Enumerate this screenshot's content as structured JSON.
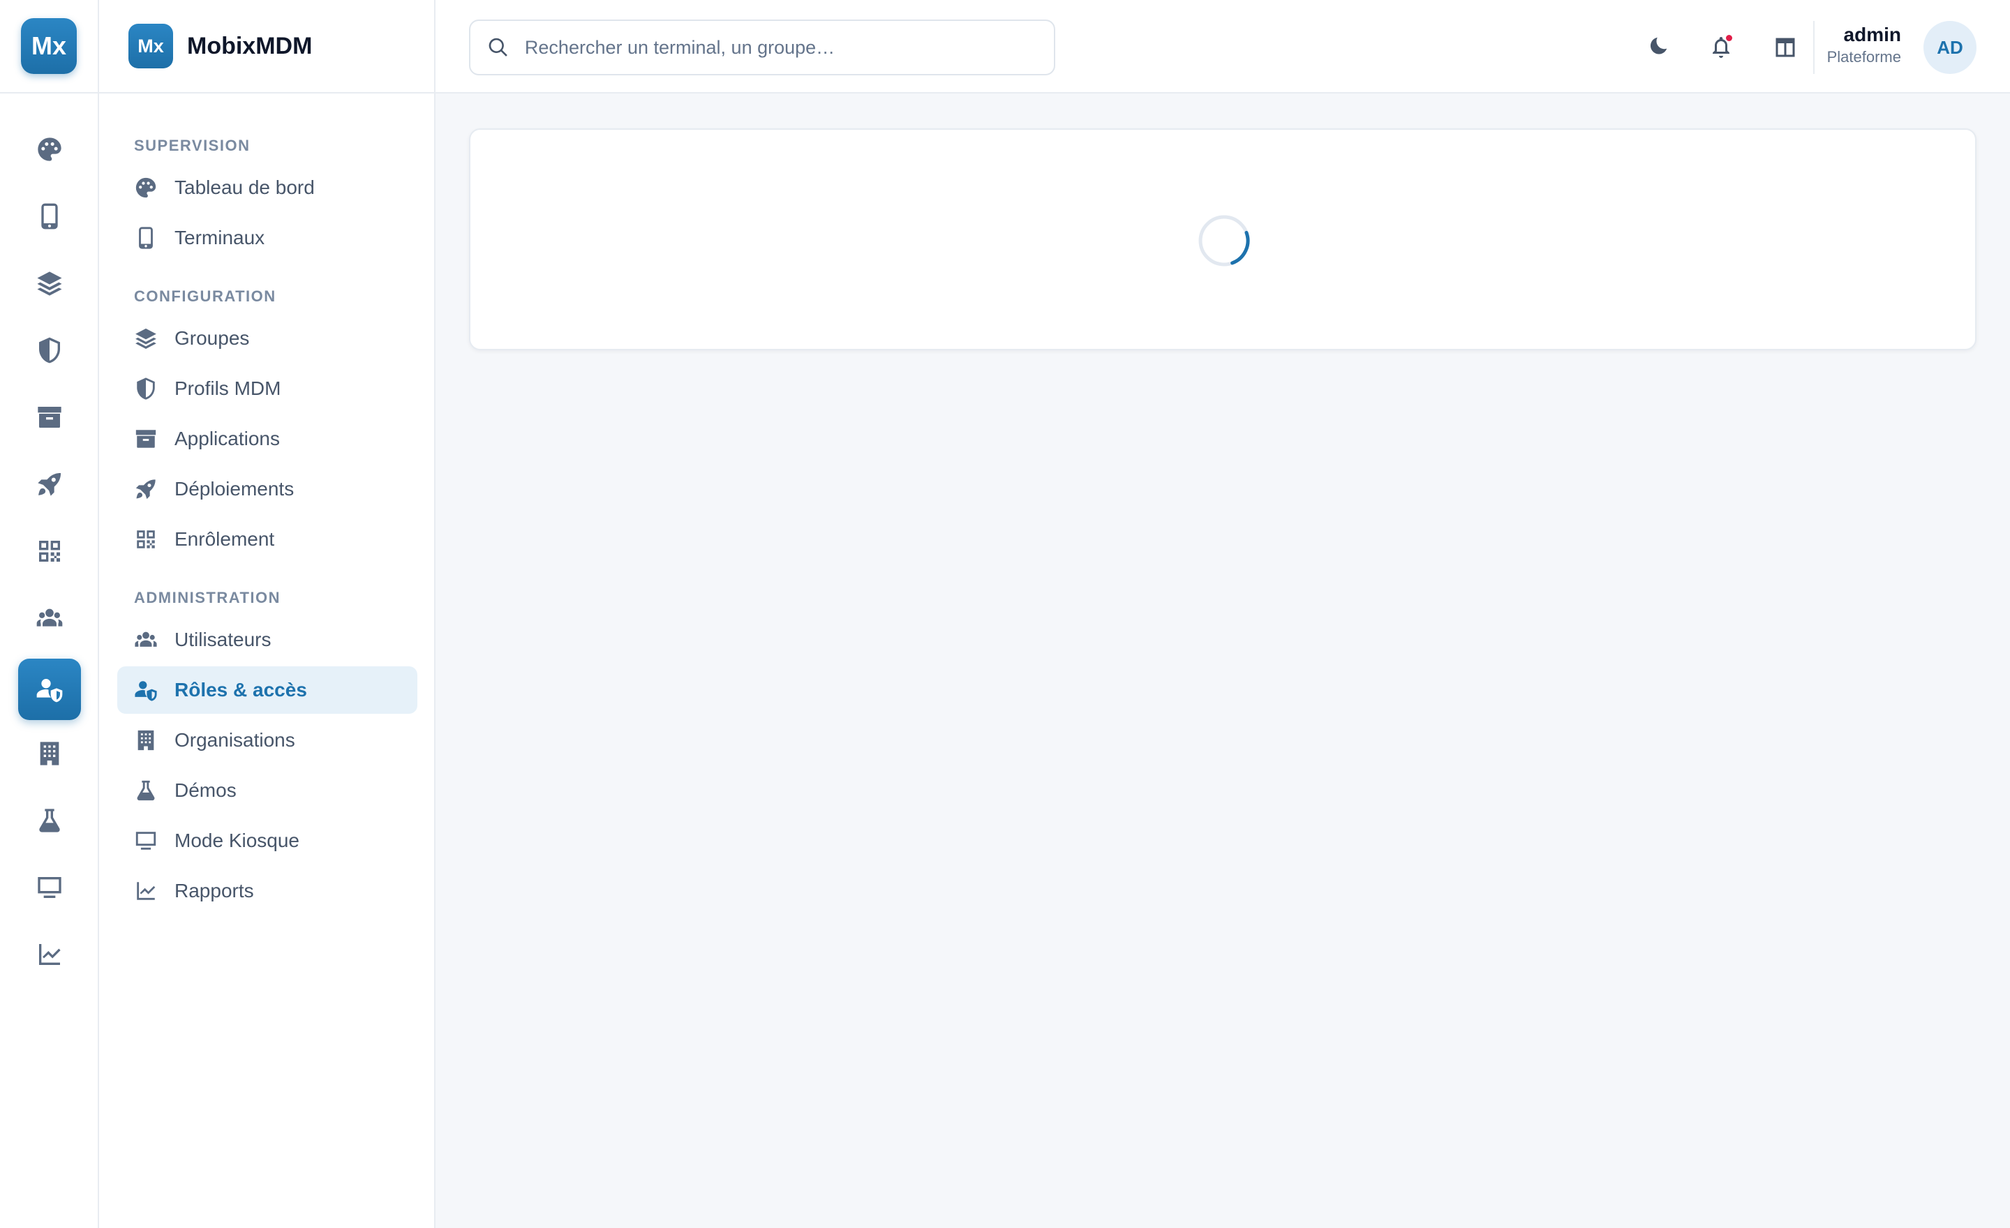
{
  "rail": {
    "logo": "Mx",
    "items": [
      {
        "name": "dashboard",
        "icon": "palette-icon"
      },
      {
        "name": "terminals",
        "icon": "phone-icon"
      },
      {
        "name": "groups",
        "icon": "layers-icon"
      },
      {
        "name": "profiles",
        "icon": "shield-icon"
      },
      {
        "name": "applications",
        "icon": "archive-icon"
      },
      {
        "name": "deployments",
        "icon": "rocket-icon"
      },
      {
        "name": "enrollment",
        "icon": "qr-code-icon"
      },
      {
        "name": "users",
        "icon": "users-icon"
      },
      {
        "name": "roles",
        "icon": "user-shield-icon",
        "active": true
      },
      {
        "name": "organisations",
        "icon": "building-icon"
      },
      {
        "name": "demos",
        "icon": "flask-icon"
      },
      {
        "name": "kiosk",
        "icon": "monitor-icon"
      },
      {
        "name": "reports",
        "icon": "chart-line-icon"
      }
    ]
  },
  "brand": {
    "logo": "Mx",
    "name": "MobixMDM"
  },
  "sidebar": {
    "sections": [
      {
        "title": "SUPERVISION"
      },
      {
        "title": "CONFIGURATION"
      },
      {
        "title": "ADMINISTRATION"
      }
    ],
    "items": [
      {
        "label": "Tableau de bord",
        "icon": "palette-icon"
      },
      {
        "label": "Terminaux",
        "icon": "phone-icon"
      },
      {
        "label": "Groupes",
        "icon": "layers-icon"
      },
      {
        "label": "Profils MDM",
        "icon": "shield-icon"
      },
      {
        "label": "Applications",
        "icon": "archive-icon"
      },
      {
        "label": "Déploiements",
        "icon": "rocket-icon"
      },
      {
        "label": "Enrôlement",
        "icon": "qr-code-icon"
      },
      {
        "label": "Utilisateurs",
        "icon": "users-icon"
      },
      {
        "label": "Rôles & accès",
        "icon": "user-shield-icon",
        "active": true
      },
      {
        "label": "Organisations",
        "icon": "building-icon"
      },
      {
        "label": "Démos",
        "icon": "flask-icon"
      },
      {
        "label": "Mode Kiosque",
        "icon": "monitor-icon"
      },
      {
        "label": "Rapports",
        "icon": "chart-line-icon"
      }
    ]
  },
  "topbar": {
    "search_placeholder": "Rechercher un terminal, un groupe…",
    "user_name": "admin",
    "user_role": "Plateforme",
    "avatar": "AD"
  },
  "colors": {
    "accent": "#1d72ad",
    "active_bg": "#e6f1f9",
    "notification_dot": "#e11d48",
    "background": "#f5f7fa"
  },
  "content": {
    "state": "loading"
  }
}
